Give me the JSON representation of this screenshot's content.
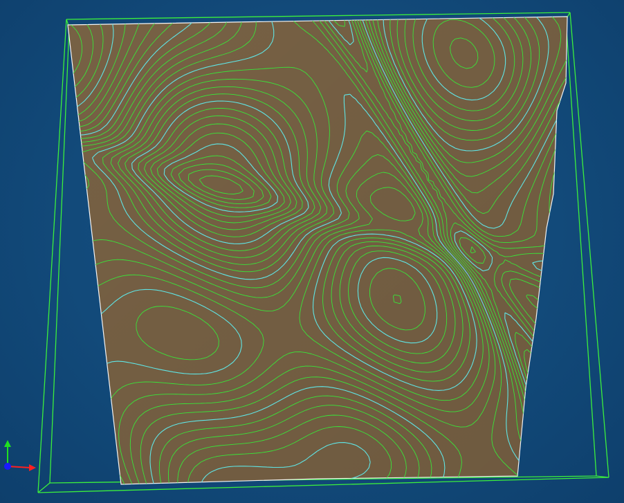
{
  "viewer": {
    "background_color": "#134c80",
    "terrain_color": "#7d6648",
    "contour_minor_color": "#39e639",
    "contour_major_color": "#5fe6e6",
    "bounding_box_color": "#3cf03c",
    "terrain_edge_color": "#ffffff"
  },
  "axes": {
    "x_axis_color": "#ff2020",
    "y_axis_color": "#20e020",
    "origin_color": "#1a1aff"
  }
}
